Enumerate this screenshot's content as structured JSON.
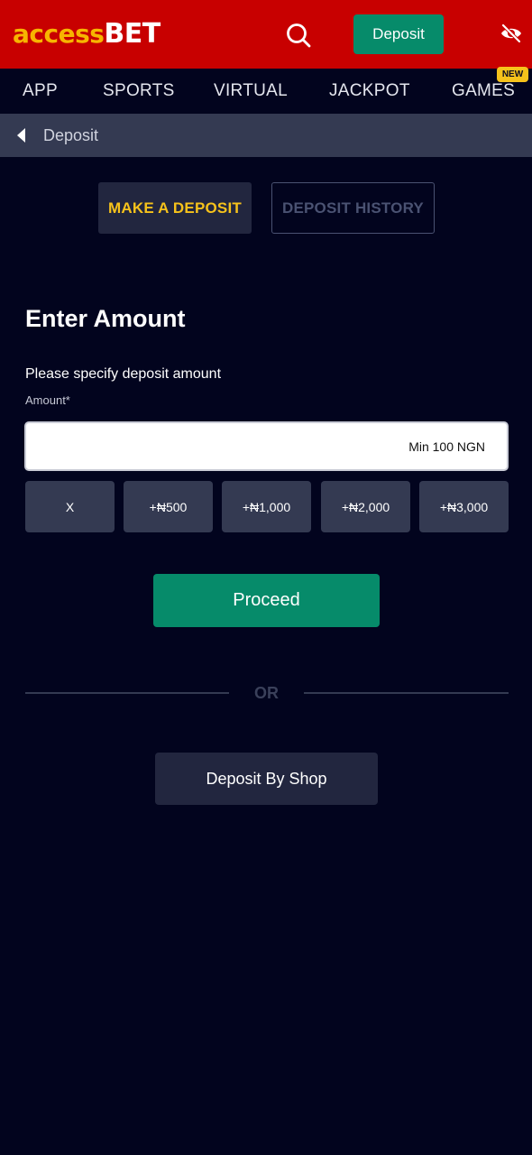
{
  "header": {
    "logo_part1": "access",
    "logo_part2": "BET",
    "deposit_label": "Deposit",
    "brand_color": "#c80000",
    "accent_color": "#068b6a"
  },
  "nav": {
    "items": [
      {
        "label": "APP"
      },
      {
        "label": "SPORTS"
      },
      {
        "label": "VIRTUAL"
      },
      {
        "label": "JACKPOT"
      },
      {
        "label": "GAMES",
        "badge": "NEW"
      }
    ]
  },
  "breadcrumb": {
    "label": "Deposit"
  },
  "tabs": [
    {
      "label": "MAKE A DEPOSIT",
      "active": true
    },
    {
      "label": "DEPOSIT HISTORY",
      "active": false
    }
  ],
  "form": {
    "title": "Enter Amount",
    "subtitle": "Please specify deposit amount",
    "amount_label": "Amount*",
    "amount_value": "",
    "amount_placeholder": "Min 100 NGN",
    "quick_amounts": [
      "X",
      "+₦500",
      "+₦1,000",
      "+₦2,000",
      "+₦3,000"
    ],
    "proceed_label": "Proceed",
    "or_label": "OR",
    "shop_label": "Deposit By Shop"
  },
  "icons": {
    "search": "search-icon",
    "visibility": "eye-off-icon",
    "back": "chevron-left-icon"
  }
}
